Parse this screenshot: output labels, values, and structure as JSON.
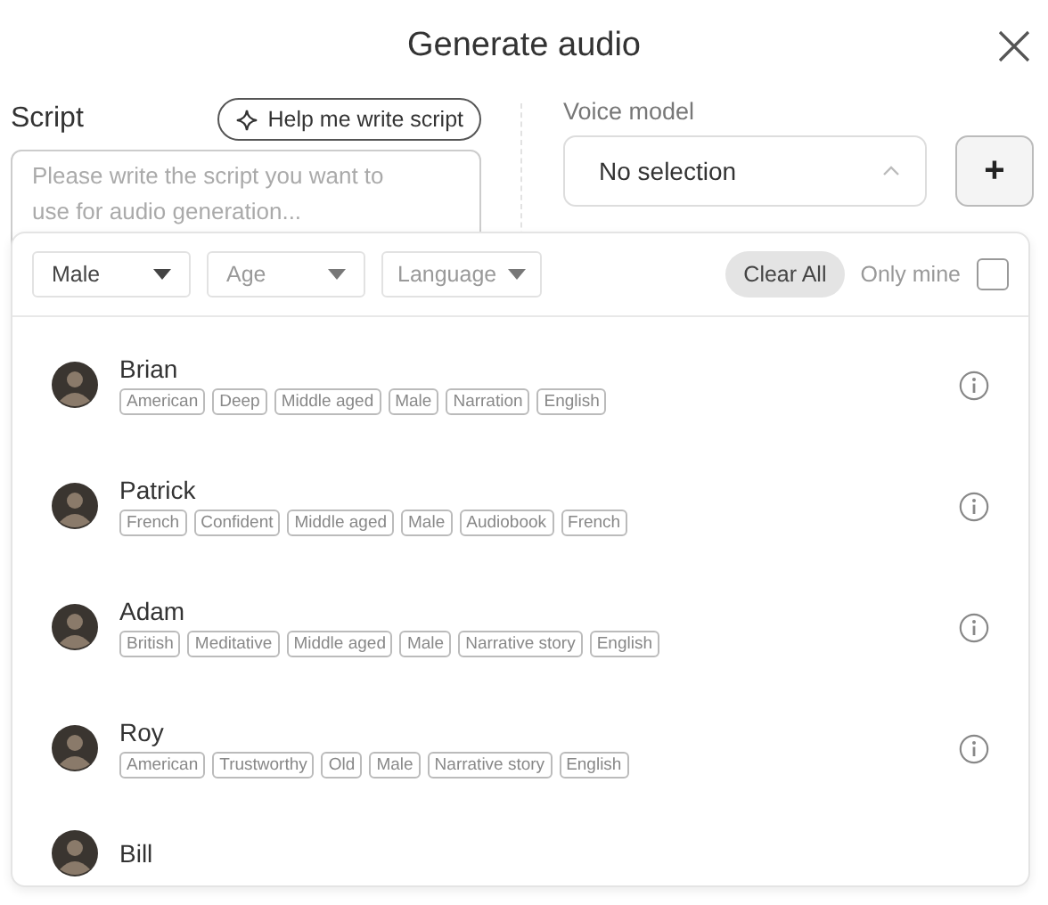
{
  "dialog": {
    "title": "Generate audio"
  },
  "script": {
    "label": "Script",
    "help_button": "Help me write script",
    "placeholder": "Please write the script you want to use for audio generation..."
  },
  "voice_model": {
    "label": "Voice model",
    "value": "No selection",
    "add_button": "+"
  },
  "filters": [
    {
      "label": "Male",
      "active": true
    },
    {
      "label": "Age",
      "active": false
    },
    {
      "label": "Language",
      "active": false
    }
  ],
  "clear_button": "Clear All",
  "only_mine": {
    "label": "Only mine",
    "checked": false
  },
  "voices": [
    {
      "name": "Brian",
      "tags": [
        "American",
        "Deep",
        "Middle aged",
        "Male",
        "Narration",
        "English"
      ]
    },
    {
      "name": "Patrick",
      "tags": [
        "French",
        "Confident",
        "Middle aged",
        "Male",
        "Audiobook",
        "French"
      ]
    },
    {
      "name": "Adam",
      "tags": [
        "British",
        "Meditative",
        "Middle aged",
        "Male",
        "Narrative story",
        "English"
      ]
    },
    {
      "name": "Roy",
      "tags": [
        "American",
        "Trustworthy",
        "Old",
        "Male",
        "Narrative story",
        "English"
      ]
    },
    {
      "name": "Bill"
    }
  ]
}
